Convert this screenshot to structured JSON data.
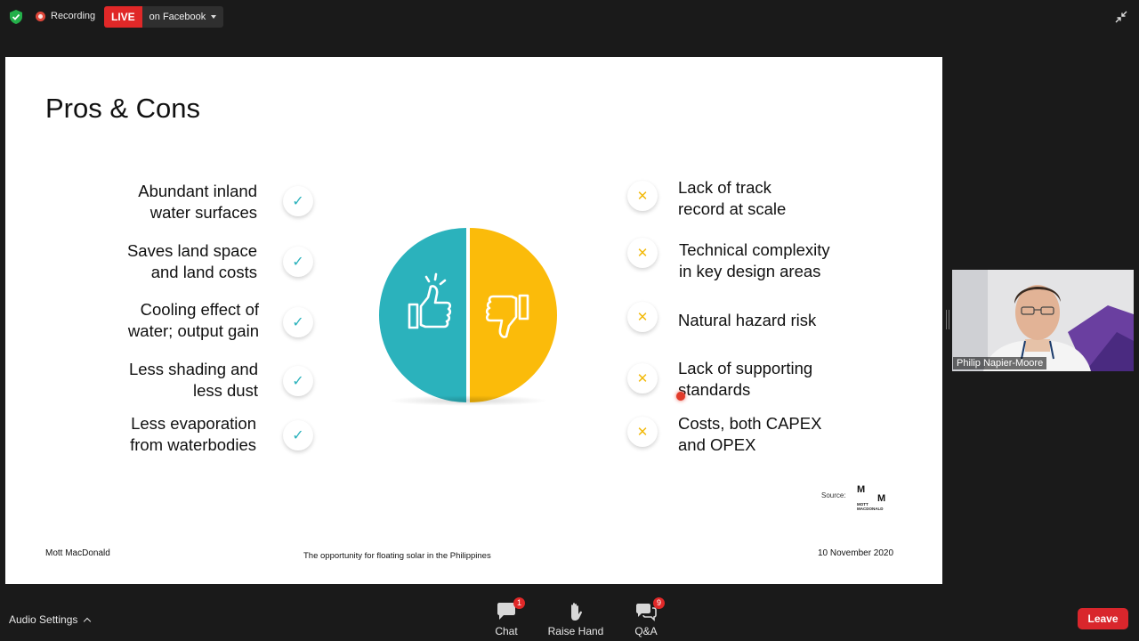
{
  "topbar": {
    "recording_label": "Recording",
    "live_label": "LIVE",
    "live_destination": "on Facebook"
  },
  "slide": {
    "title": "Pros & Cons",
    "pros": [
      {
        "line1": "Abundant inland",
        "line2": "water surfaces"
      },
      {
        "line1": "Saves land space",
        "line2": "and land costs"
      },
      {
        "line1": "Cooling effect of",
        "line2": "water; output gain"
      },
      {
        "line1": "Less shading and",
        "line2": "less dust"
      },
      {
        "line1": "Less evaporation",
        "line2": "from waterbodies"
      }
    ],
    "cons": [
      {
        "line1": "Lack of track",
        "line2": "record at scale"
      },
      {
        "line1": "Technical complexity",
        "line2": "in key design areas"
      },
      {
        "line1": "Natural hazard risk",
        "line2": ""
      },
      {
        "line1": "Lack of supporting",
        "line2": "standards"
      },
      {
        "line1": "Costs, both CAPEX",
        "line2": "and OPEX"
      }
    ],
    "check_glyph": "✓",
    "cross_glyph": "✕",
    "source_label": "Source:",
    "logo": {
      "m1": "M",
      "m2": "M",
      "name_line1": "MOTT",
      "name_line2": "MACDONALD"
    },
    "footer_left": "Mott MacDonald",
    "footer_center": "The opportunity for floating solar in the Philippines",
    "footer_right": "10 November 2020",
    "colors": {
      "pro": "#2bb2bc",
      "con": "#fbbb0a"
    }
  },
  "video": {
    "participant_name": "Philip Napier-Moore"
  },
  "bottombar": {
    "audio_settings_label": "Audio Settings",
    "chat_label": "Chat",
    "chat_badge": "1",
    "raise_hand_label": "Raise Hand",
    "qa_label": "Q&A",
    "qa_badge": "9",
    "leave_label": "Leave"
  }
}
